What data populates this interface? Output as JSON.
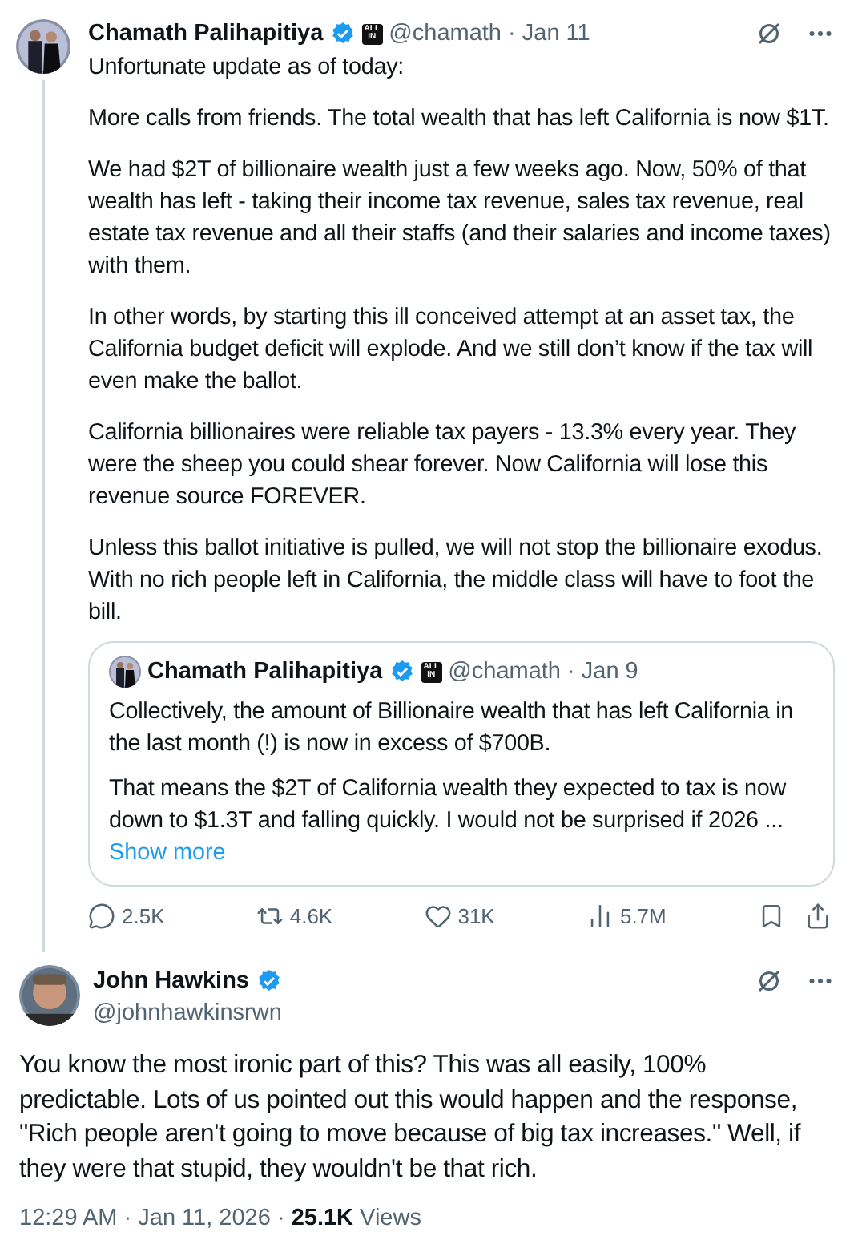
{
  "post": {
    "author": {
      "name": "Chamath Palihapitiya",
      "verified": true,
      "affiliate_badge": "ALL IN",
      "handle": "@chamath",
      "separator": "·",
      "date": "Jan 11"
    },
    "paragraphs": [
      "Unfortunate update as of today:",
      "More calls from friends. The total wealth that has left California is now $1T.",
      "We had $2T of billionaire wealth just a few weeks ago. Now, 50% of that wealth has left - taking their income tax revenue, sales tax revenue, real estate tax revenue and all their staffs (and their salaries and income taxes) with them.",
      "In other words, by starting this ill conceived attempt at an asset tax, the California budget deficit will explode. And we still don’t know if the tax will even make the ballot.",
      "California billionaires were reliable tax payers - 13.3% every year. They were the sheep you could shear forever.  Now California will lose this revenue source FOREVER.",
      "Unless this ballot initiative is pulled, we will not stop the billionaire exodus. With no rich people left in California, the middle class will have to foot the bill."
    ],
    "quote": {
      "author": {
        "name": "Chamath Palihapitiya",
        "verified": true,
        "affiliate_badge": "ALL IN",
        "handle": "@chamath",
        "separator": "·",
        "date": "Jan 9"
      },
      "paragraphs": [
        "Collectively, the amount of Billionaire wealth that has left California in the last month (!) is now in excess of $700B.",
        "That means the $2T of California wealth they expected to tax is now down to $1.3T and falling quickly. I would not be surprised if 2026 ..."
      ],
      "show_more": "Show more"
    },
    "actions": [
      {
        "kind": "reply",
        "count": "2.5K"
      },
      {
        "kind": "repost",
        "count": "4.6K"
      },
      {
        "kind": "like",
        "count": "31K"
      },
      {
        "kind": "views",
        "count": "5.7M"
      },
      {
        "kind": "bookmark"
      },
      {
        "kind": "share"
      }
    ]
  },
  "reply": {
    "author": {
      "name": "John Hawkins",
      "verified": true,
      "handle": "@johnhawkinsrwn"
    },
    "text": "You know the most ironic part of this? This was all easily, 100% predictable. Lots of us pointed out this would happen and the response, \"Rich people aren't going to move because of big tax increases.\" Well, if they  were that stupid, they wouldn't be that rich.",
    "time": "12:29 AM · Jan 11, 2026 · ",
    "views_count": "25.1K",
    "views_label": "Views"
  }
}
